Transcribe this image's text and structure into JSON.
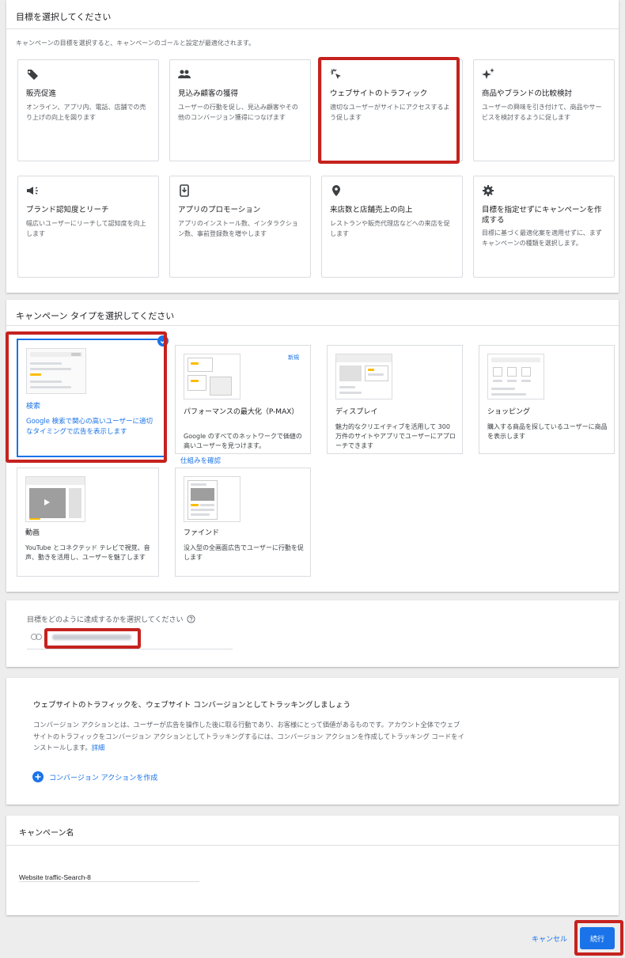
{
  "goal": {
    "heading": "目標を選択してください",
    "subtitle": "キャンペーンの目標を選択すると、キャンペーンのゴールと設定が最適化されます。",
    "cards": [
      {
        "icon": "tag-icon",
        "title": "販売促進",
        "desc": "オンライン、アプリ内、電話、店舗での売り上げの向上を図ります"
      },
      {
        "icon": "people-icon",
        "title": "見込み顧客の獲得",
        "desc": "ユーザーの行動を促し、見込み顧客やその他のコンバージョン獲得につなげます"
      },
      {
        "icon": "cursor-click-icon",
        "title": "ウェブサイトのトラフィック",
        "desc": "適切なユーザーがサイトにアクセスするよう促します"
      },
      {
        "icon": "sparkle-icon",
        "title": "商品やブランドの比較検討",
        "desc": "ユーザーの興味を引き付けて、商品やサービスを検討するように促します"
      },
      {
        "icon": "megaphone-icon",
        "title": "ブランド認知度とリーチ",
        "desc": "幅広いユーザーにリーチして認知度を向上します"
      },
      {
        "icon": "phone-download-icon",
        "title": "アプリのプロモーション",
        "desc": "アプリのインストール数、インタラクション数、事前登録数を増やします"
      },
      {
        "icon": "location-pin-icon",
        "title": "来店数と店舗売上の向上",
        "desc": "レストランや販売代理店などへの来店を促します"
      },
      {
        "icon": "gear-icon",
        "title": "目標を指定せずにキャンペーンを作成する",
        "desc": "目標に基づく最適化案を適用せずに、まずキャンペーンの種類を選択します。"
      }
    ]
  },
  "type": {
    "heading": "キャンペーン タイプを選択してください",
    "cards": [
      {
        "name": "search",
        "title": "検索",
        "desc": "Google 検索で関心の高いユーザーに適切なタイミングで広告を表示します"
      },
      {
        "name": "pmax",
        "title": "パフォーマンスの最大化（P-MAX）",
        "desc": "Google のすべてのネットワークで価値の高いユーザーを見つけます。",
        "badge": "新規",
        "link": "仕組みを確認"
      },
      {
        "name": "display",
        "title": "ディスプレイ",
        "desc": "魅力的なクリエイティブを活用して 300 万件のサイトやアプリでユーザーにアプローチできます"
      },
      {
        "name": "shopping",
        "title": "ショッピング",
        "desc": "購入する商品を探しているユーザーに商品を表示します"
      },
      {
        "name": "video",
        "title": "動画",
        "desc": "YouTube とコネクテッド テレビで視覚、音声、動きを活用し、ユーザーを魅了します"
      },
      {
        "name": "discovery",
        "title": "ファインド",
        "desc": "没入型の全画面広告でユーザーに行動を促します"
      }
    ]
  },
  "reach": {
    "heading": "目標をどのように達成するかを選択してください"
  },
  "conversion": {
    "heading": "ウェブサイトのトラフィックを、ウェブサイト コンバージョンとしてトラッキングしましょう",
    "lines": [
      "コンバージョン アクションとは、ユーザーが広告を操作した後に取る行動であり、お客様にとって価値があるものです。アカウント全体でウェブ",
      "サイトのトラフィックをコンバージョン アクションとしてトラッキングするには、コンバージョン アクションを作成してトラッキング コードをイ",
      "ンストールします。"
    ],
    "details_link": "詳細",
    "create_label": "コンバージョン アクションを作成"
  },
  "campaign_name": {
    "heading": "キャンペーン名",
    "value": "Website traffic-Search-8"
  },
  "footer": {
    "cancel": "キャンセル",
    "continue": "続行"
  },
  "colors": {
    "accent": "#1a73e8",
    "highlight": "#c5221f"
  }
}
